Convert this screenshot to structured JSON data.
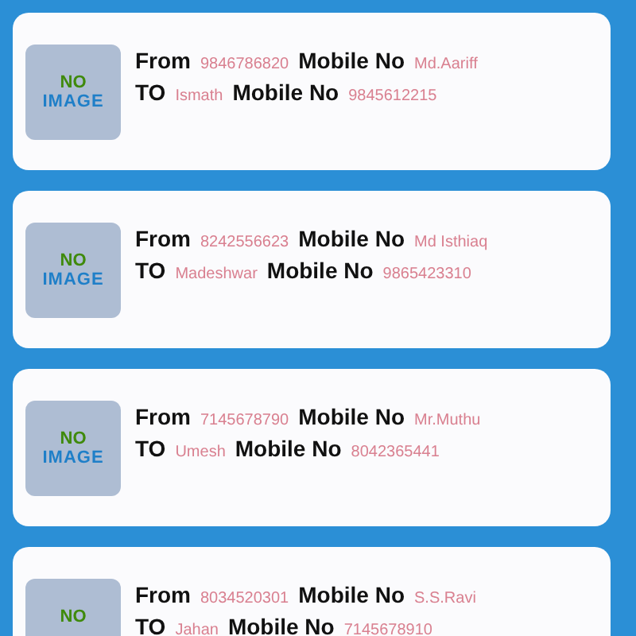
{
  "messages": [
    {
      "thumbnail": {
        "top": "NO",
        "bottom": "IMAGE"
      },
      "from_label": "From",
      "from_value": "9846786820",
      "from_mobile_label": "Mobile No",
      "from_mobile_value": "Md.Aariff",
      "to_label": "TO",
      "to_value": "Ismath",
      "to_mobile_label": "Mobile No",
      "to_mobile_value": "9845612215"
    },
    {
      "thumbnail": {
        "top": "NO",
        "bottom": "IMAGE"
      },
      "from_label": "From",
      "from_value": "8242556623",
      "from_mobile_label": "Mobile No",
      "from_mobile_value": "Md Isthiaq",
      "to_label": "TO",
      "to_value": "Madeshwar",
      "to_mobile_label": "Mobile No",
      "to_mobile_value": "9865423310"
    },
    {
      "thumbnail": {
        "top": "NO",
        "bottom": "IMAGE"
      },
      "from_label": "From",
      "from_value": "7145678790",
      "from_mobile_label": "Mobile No",
      "from_mobile_value": "Mr.Muthu",
      "to_label": "TO",
      "to_value": "Umesh",
      "to_mobile_label": "Mobile No",
      "to_mobile_value": "8042365441"
    },
    {
      "thumbnail": {
        "top": "NO"
      },
      "from_label": "From",
      "from_value": "8034520301",
      "from_mobile_label": "Mobile No",
      "from_mobile_value": "S.S.Ravi",
      "to_label": "TO",
      "to_value": "Jahan",
      "to_mobile_label": "Mobile No",
      "to_mobile_value": "7145678910"
    }
  ]
}
